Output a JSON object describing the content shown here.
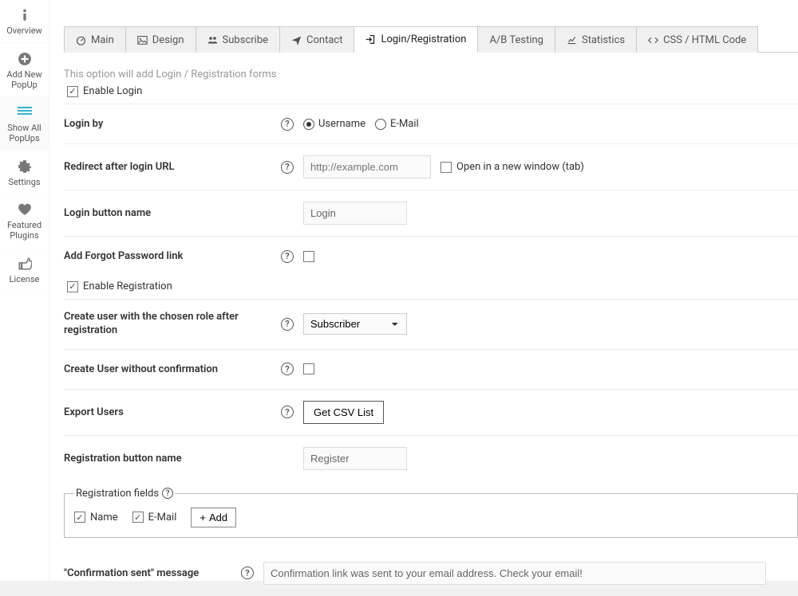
{
  "sidebar": [
    {
      "label": "Overview"
    },
    {
      "label": "Add New PopUp"
    },
    {
      "label": "Show All PopUps"
    },
    {
      "label": "Settings"
    },
    {
      "label": "Featured Plugins"
    },
    {
      "label": "License"
    }
  ],
  "tabs": [
    {
      "label": "Main"
    },
    {
      "label": "Design"
    },
    {
      "label": "Subscribe"
    },
    {
      "label": "Contact"
    },
    {
      "label": "Login/Registration"
    },
    {
      "label": "A/B Testing"
    },
    {
      "label": "Statistics"
    },
    {
      "label": "CSS / HTML Code"
    }
  ],
  "form": {
    "intro": "This option will add Login / Registration forms",
    "enable_login_label": "Enable Login",
    "login_by_label": "Login by",
    "login_by_options": {
      "username": "Username",
      "email": "E-Mail"
    },
    "redirect_label": "Redirect after login URL",
    "redirect_placeholder": "http://example.com",
    "open_new_window_label": "Open in a new window (tab)",
    "login_button_name_label": "Login button name",
    "login_button_name_value": "Login",
    "forgot_pw_label": "Add Forgot Password link",
    "enable_registration_label": "Enable Registration",
    "create_role_label": "Create user with the chosen role after registration",
    "create_role_value": "Subscriber",
    "create_no_confirm_label": "Create User without confirmation",
    "export_users_label": "Export Users",
    "export_users_button": "Get CSV List",
    "register_button_name_label": "Registration button name",
    "register_button_name_value": "Register",
    "reg_fields_legend": "Registration fields",
    "reg_fields": {
      "name": "Name",
      "email": "E-Mail",
      "add": "Add"
    },
    "confirmation_label": "\"Confirmation sent\" message",
    "confirmation_value": "Confirmation link was sent to your email address. Check your email!"
  }
}
